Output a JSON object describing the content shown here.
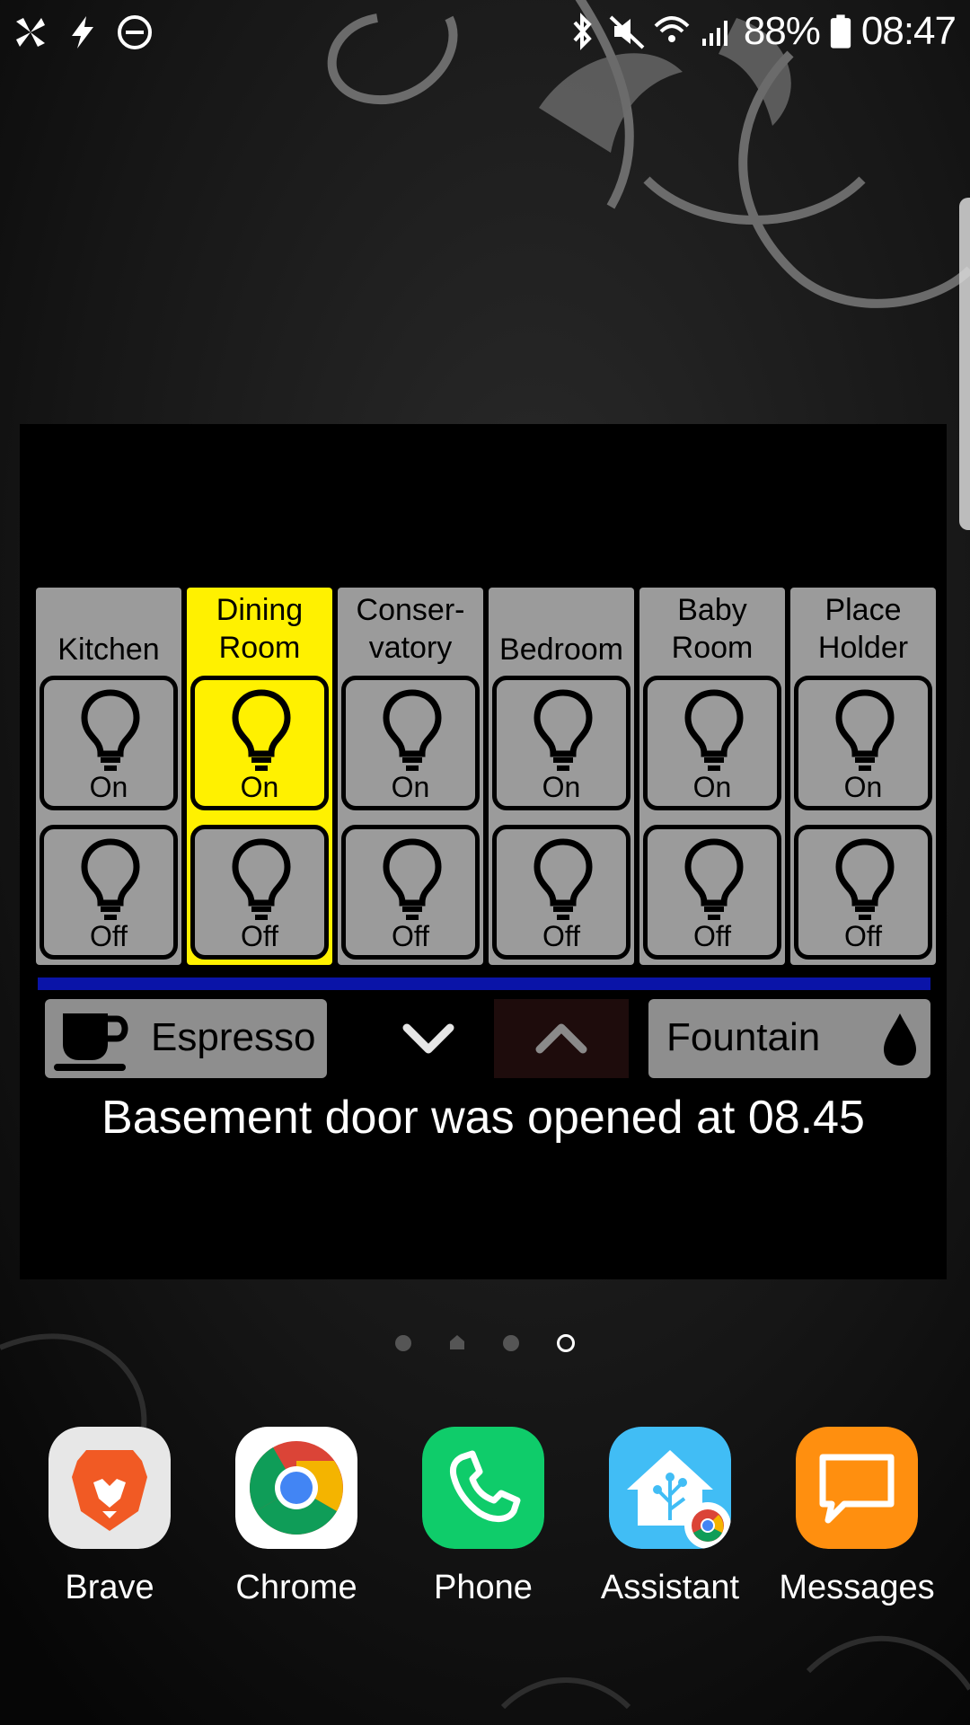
{
  "status_bar": {
    "battery": "88%",
    "time": "08:47"
  },
  "widget": {
    "rooms": [
      {
        "label": "Kitchen",
        "on_label": "On",
        "off_label": "Off",
        "active": false
      },
      {
        "label": "Dining\nRoom",
        "on_label": "On",
        "off_label": "Off",
        "active": true
      },
      {
        "label": "Conser-\nvatory",
        "on_label": "On",
        "off_label": "Off",
        "active": false
      },
      {
        "label": "Bedroom",
        "on_label": "On",
        "off_label": "Off",
        "active": false
      },
      {
        "label": "Baby\nRoom",
        "on_label": "On",
        "off_label": "Off",
        "active": false
      },
      {
        "label": "Place\nHolder",
        "on_label": "On",
        "off_label": "Off",
        "active": false
      }
    ],
    "espresso_label": "Espresso",
    "fountain_label": "Fountain",
    "alert": "Basement door was opened at 08.45"
  },
  "colors": {
    "active_room": "#fff100",
    "inactive_room": "#9b9b9b",
    "divider": "#0a14a8"
  },
  "page_indicator": {
    "count": 4,
    "current_index": 3
  },
  "dock": {
    "apps": [
      {
        "name": "Brave",
        "icon": "brave-lion-icon"
      },
      {
        "name": "Chrome",
        "icon": "chrome-icon"
      },
      {
        "name": "Phone",
        "icon": "phone-icon"
      },
      {
        "name": "Assistant",
        "icon": "home-assistant-icon"
      },
      {
        "name": "Messages",
        "icon": "messages-icon"
      }
    ]
  }
}
